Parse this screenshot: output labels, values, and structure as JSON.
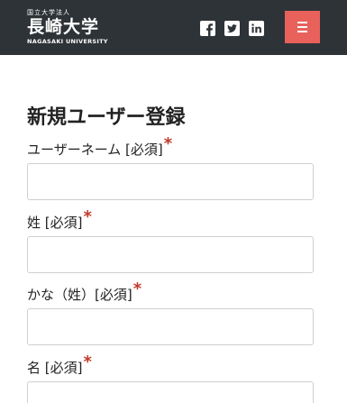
{
  "header": {
    "org_label": "国立大学法人",
    "university_name": "長崎大学",
    "university_en": "NAGASAKI UNIVERSITY",
    "social": [
      "facebook-icon",
      "twitter-icon",
      "linkedin-icon"
    ],
    "bg_color": "#2e3338",
    "menu_color": "#e8615b"
  },
  "page": {
    "title": "新規ユーザー登録"
  },
  "form": {
    "required_mark": "*",
    "fields": [
      {
        "label": "ユーザーネーム [必須]",
        "value": ""
      },
      {
        "label": "姓 [必須]",
        "value": ""
      },
      {
        "label": "かな（姓）[必須]",
        "value": ""
      },
      {
        "label": "名 [必須]",
        "value": ""
      }
    ]
  }
}
